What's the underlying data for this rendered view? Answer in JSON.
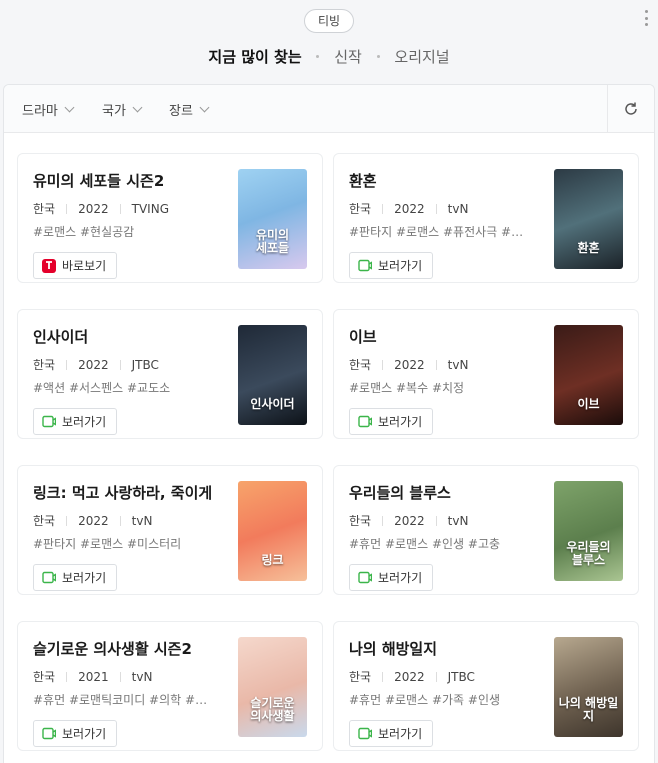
{
  "header": {
    "chip": "티빙",
    "tabs": [
      "지금 많이 찾는",
      "신작",
      "오리지널"
    ]
  },
  "filters": [
    "드라마",
    "국가",
    "장르"
  ],
  "colors": {
    "accent_tving": "#e4002b",
    "watch_icon": "#3bb54a"
  },
  "cards": [
    {
      "title": "유미의 세포들 시즌2",
      "country": "한국",
      "year": "2022",
      "network": "TVING",
      "tags": "#로맨스  #현실공감",
      "button": "바로보기",
      "icon": "tving-icon",
      "poster_text": "유미의\n세포들"
    },
    {
      "title": "환혼",
      "country": "한국",
      "year": "2022",
      "network": "tvN",
      "tags": "#판타지  #로맨스  #퓨전사극  #…",
      "button": "보러가기",
      "icon": "play-icon",
      "poster_text": "환혼"
    },
    {
      "title": "인사이더",
      "country": "한국",
      "year": "2022",
      "network": "JTBC",
      "tags": "#액션  #서스펜스  #교도소",
      "button": "보러가기",
      "icon": "play-icon",
      "poster_text": "인사이더"
    },
    {
      "title": "이브",
      "country": "한국",
      "year": "2022",
      "network": "tvN",
      "tags": "#로맨스  #복수  #치정",
      "button": "보러가기",
      "icon": "play-icon",
      "poster_text": "이브"
    },
    {
      "title": "링크: 먹고 사랑하라, 죽이게",
      "country": "한국",
      "year": "2022",
      "network": "tvN",
      "tags": "#판타지  #로맨스  #미스터리",
      "button": "보러가기",
      "icon": "play-icon",
      "poster_text": "링크"
    },
    {
      "title": "우리들의 블루스",
      "country": "한국",
      "year": "2022",
      "network": "tvN",
      "tags": "#휴먼  #로맨스  #인생  #고충",
      "button": "보러가기",
      "icon": "play-icon",
      "poster_text": "우리들의\n블루스"
    },
    {
      "title": "슬기로운 의사생활 시즌2",
      "country": "한국",
      "year": "2021",
      "network": "tvN",
      "tags": "#휴먼  #로맨틱코미디  #의학  #…",
      "button": "보러가기",
      "icon": "play-icon",
      "poster_text": "슬기로운\n의사생활"
    },
    {
      "title": "나의 해방일지",
      "country": "한국",
      "year": "2022",
      "network": "JTBC",
      "tags": "#휴먼  #로맨스  #가족  #인생",
      "button": "보러가기",
      "icon": "play-icon",
      "poster_text": "나의 해방일지"
    }
  ]
}
